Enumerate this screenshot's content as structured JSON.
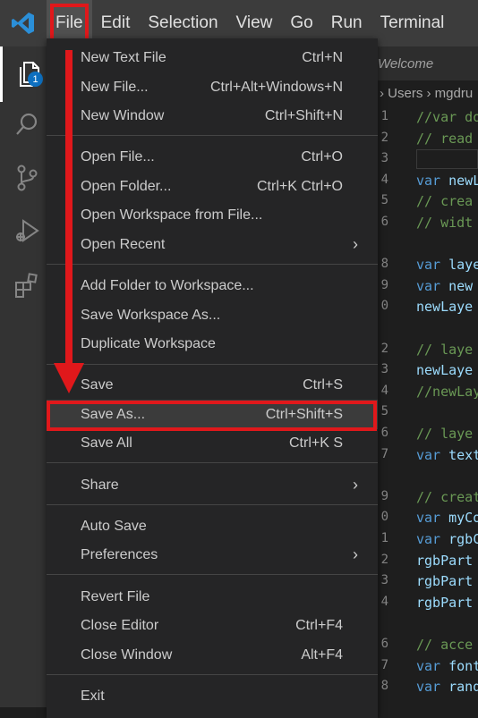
{
  "menubar": {
    "items": [
      "File",
      "Edit",
      "Selection",
      "View",
      "Go",
      "Run",
      "Terminal"
    ]
  },
  "activity": {
    "badge": "1"
  },
  "editor": {
    "tab_label": "Welcome",
    "breadcrumb": "› Users › mgdru",
    "line_numbers": [
      "1",
      "2",
      "3",
      "4",
      "5",
      "6",
      "",
      "8",
      "9",
      "0",
      "",
      "2",
      "3",
      "4",
      "5",
      "6",
      "7",
      "",
      "9",
      "0",
      "1",
      "2",
      "3",
      "4",
      "",
      "6",
      "7",
      "8"
    ],
    "lines": [
      {
        "text": "//var do",
        "kind": "comment"
      },
      {
        "text": "// read",
        "kind": "comment"
      },
      {
        "text": "",
        "kind": "plain"
      },
      {
        "text": "var newL",
        "kind": "var"
      },
      {
        "text": "// crea",
        "kind": "comment"
      },
      {
        "text": "// widt",
        "kind": "comment"
      },
      {
        "text": "",
        "kind": "plain"
      },
      {
        "text": "var laye",
        "kind": "var"
      },
      {
        "text": "var new",
        "kind": "var"
      },
      {
        "text": "newLaye",
        "kind": "ident"
      },
      {
        "text": "",
        "kind": "plain"
      },
      {
        "text": "// laye",
        "kind": "comment"
      },
      {
        "text": "newLaye",
        "kind": "ident"
      },
      {
        "text": "//newLay",
        "kind": "comment"
      },
      {
        "text": "",
        "kind": "plain"
      },
      {
        "text": "// laye",
        "kind": "comment"
      },
      {
        "text": "var text",
        "kind": "var"
      },
      {
        "text": "",
        "kind": "plain"
      },
      {
        "text": "// creat",
        "kind": "comment"
      },
      {
        "text": "var myCo",
        "kind": "var"
      },
      {
        "text": "var rgbC",
        "kind": "var"
      },
      {
        "text": "rgbPart",
        "kind": "ident"
      },
      {
        "text": "rgbPart",
        "kind": "ident"
      },
      {
        "text": "rgbPart",
        "kind": "ident"
      },
      {
        "text": "",
        "kind": "plain"
      },
      {
        "text": "// acce",
        "kind": "comment"
      },
      {
        "text": "var font",
        "kind": "var"
      },
      {
        "text": "var rand",
        "kind": "var"
      }
    ]
  },
  "file_menu": {
    "items": [
      {
        "label": "New Text File",
        "shortcut": "Ctrl+N"
      },
      {
        "label": "New File...",
        "shortcut": "Ctrl+Alt+Windows+N"
      },
      {
        "label": "New Window",
        "shortcut": "Ctrl+Shift+N"
      },
      {
        "label": "Open File...",
        "shortcut": "Ctrl+O"
      },
      {
        "label": "Open Folder...",
        "shortcut": "Ctrl+K Ctrl+O"
      },
      {
        "label": "Open Workspace from File...",
        "shortcut": ""
      },
      {
        "label": "Open Recent",
        "shortcut": ""
      },
      {
        "label": "Add Folder to Workspace...",
        "shortcut": ""
      },
      {
        "label": "Save Workspace As...",
        "shortcut": ""
      },
      {
        "label": "Duplicate Workspace",
        "shortcut": ""
      },
      {
        "label": "Save",
        "shortcut": "Ctrl+S"
      },
      {
        "label": "Save As...",
        "shortcut": "Ctrl+Shift+S"
      },
      {
        "label": "Save All",
        "shortcut": "Ctrl+K S"
      },
      {
        "label": "Share",
        "shortcut": ""
      },
      {
        "label": "Auto Save",
        "shortcut": ""
      },
      {
        "label": "Preferences",
        "shortcut": ""
      },
      {
        "label": "Revert File",
        "shortcut": ""
      },
      {
        "label": "Close Editor",
        "shortcut": "Ctrl+F4"
      },
      {
        "label": "Close Window",
        "shortcut": "Alt+F4"
      },
      {
        "label": "Exit",
        "shortcut": ""
      }
    ]
  },
  "colors": {
    "annotation_red": "#e0181b",
    "menu_bg": "#252526",
    "titlebar_bg": "#3c3c3c",
    "accent_blue": "#0e70c0"
  }
}
